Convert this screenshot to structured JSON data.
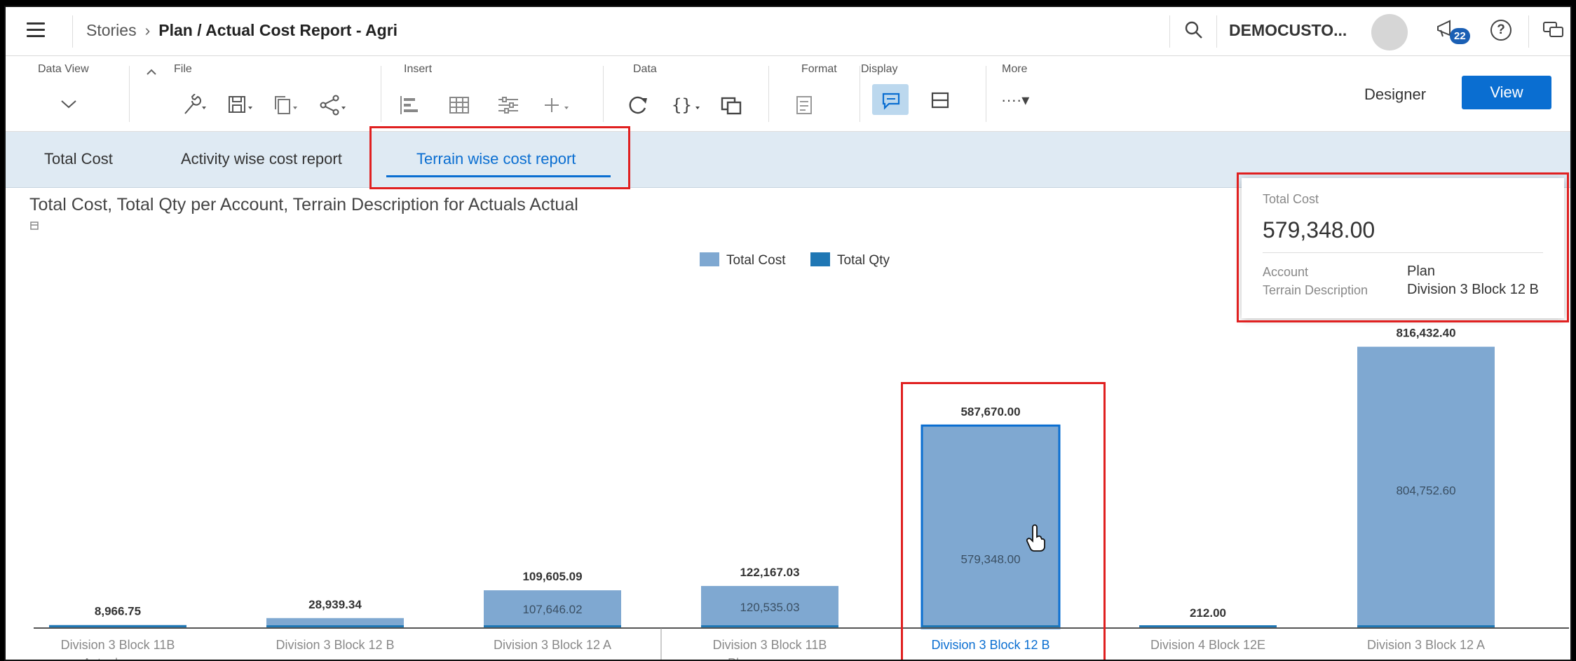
{
  "shell": {
    "breadcrumb_root": "Stories",
    "breadcrumb_sep": "›",
    "story_title": "Plan / Actual Cost Report - Agri",
    "tenant": "DEMOCUSTO...",
    "notification_count": "22",
    "help": "?"
  },
  "toolbar": {
    "data_view": "Data View",
    "file": "File",
    "insert": "Insert",
    "data": "Data",
    "format": "Format",
    "display": "Display",
    "more": "More",
    "more_dots": "····▾",
    "designer": "Designer",
    "view": "View"
  },
  "tabs": [
    "Total Cost",
    "Activity wise cost report",
    "Terrain wise cost report"
  ],
  "chart_data": {
    "type": "bar",
    "title": "Total Cost, Total Qty per Account, Terrain Description for Actuals Actual",
    "series": [
      {
        "name": "Total Cost",
        "color": "#7fa8d1"
      },
      {
        "name": "Total Qty",
        "color": "#1f77b4"
      }
    ],
    "categories": [
      "Division 3 Block 11B",
      "Division 3 Block 12 B",
      "Division 3 Block 12 A",
      "Division 3 Block 11B",
      "Division 3 Block 12 B",
      "Division 4 Block 12E",
      "Division 3 Block 12 A"
    ],
    "groups": [
      "Actual",
      "Plan"
    ],
    "group_label_partial": [
      "Actual",
      "Plan"
    ],
    "total_labels": [
      "8,966.75",
      "28,939.34",
      "109,605.09",
      "122,167.03",
      "587,670.00",
      "212.00",
      "816,432.40"
    ],
    "values": [
      8966.75,
      28939.34,
      109605.09,
      122167.03,
      587670.0,
      212.0,
      816432.4
    ],
    "cost_labels": [
      "",
      "",
      "107,646.02",
      "120,535.03",
      "579,348.00",
      "",
      "804,752.60"
    ],
    "selected_index": 4,
    "ylim": [
      0,
      830000
    ]
  },
  "tooltip": {
    "measure_label": "Total Cost",
    "measure_value": "579,348.00",
    "rows": [
      {
        "label": "Account",
        "value": "Plan"
      },
      {
        "label": "Terrain Description",
        "value": "Division 3 Block 12 B"
      }
    ]
  }
}
